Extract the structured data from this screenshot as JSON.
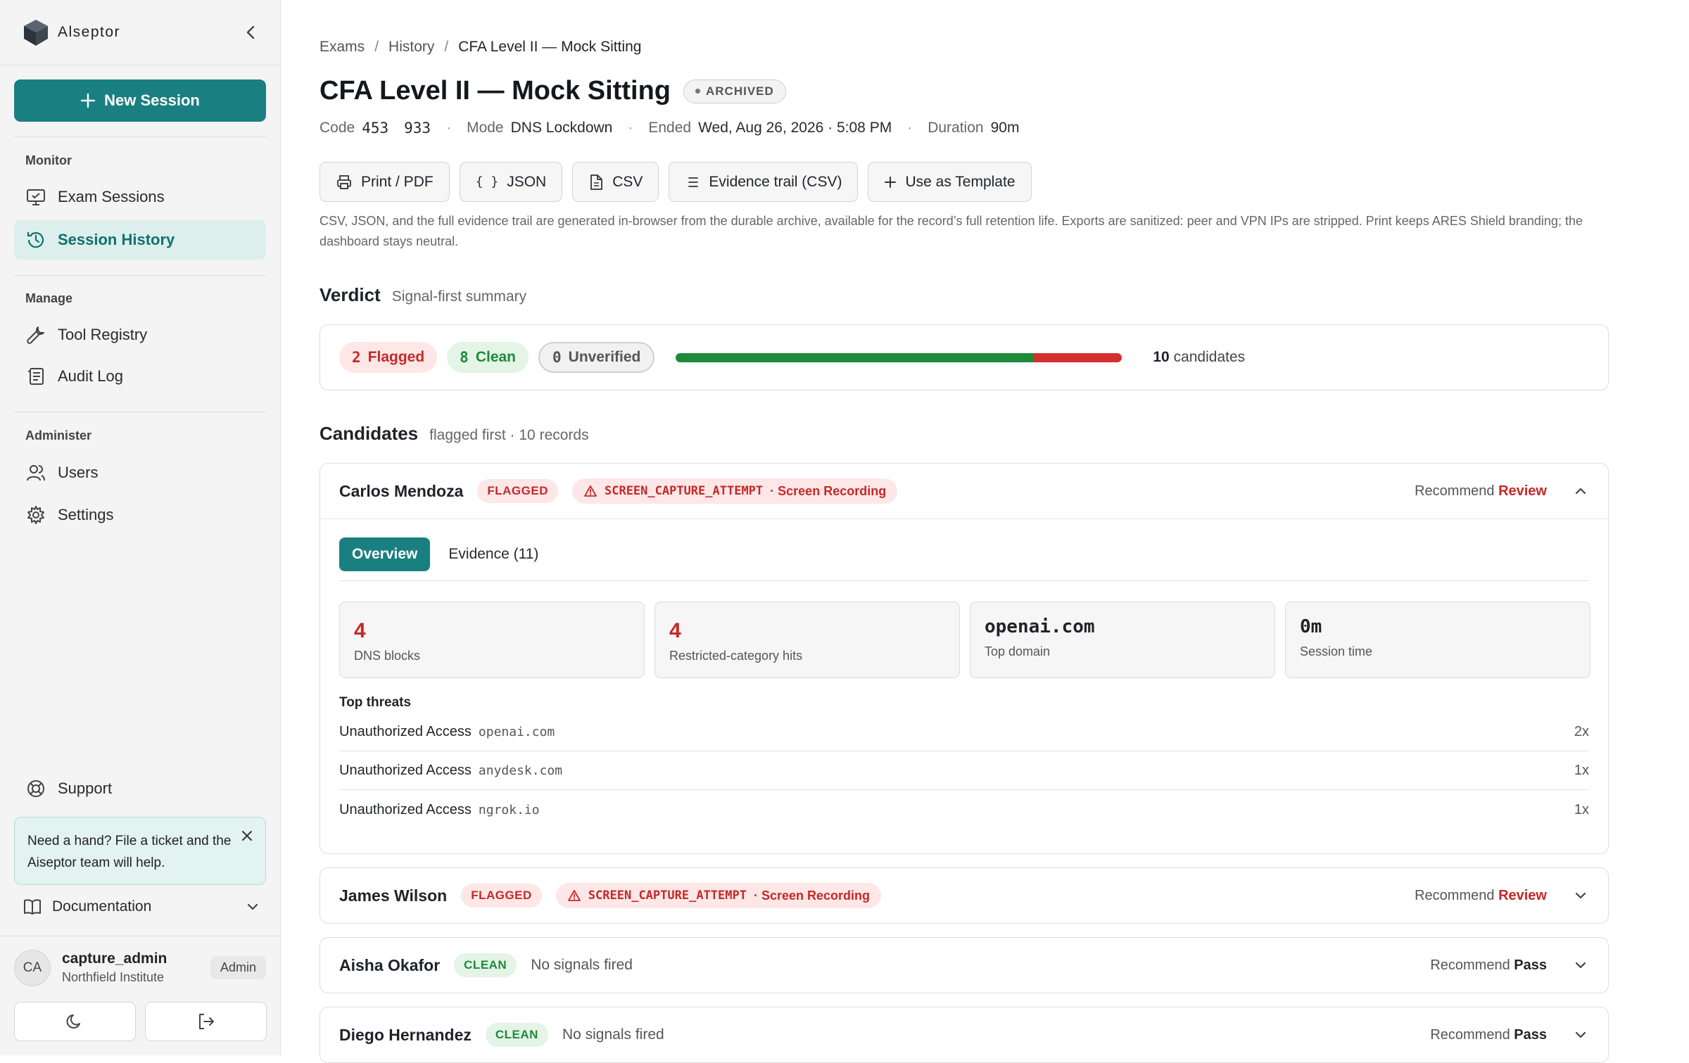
{
  "app": {
    "name": "Alseptor"
  },
  "sidebar": {
    "new_session_label": "New Session",
    "sections": {
      "monitor": "Monitor",
      "manage": "Manage",
      "administer": "Administer"
    },
    "items": {
      "exam_sessions": "Exam Sessions",
      "session_history": "Session History",
      "tool_registry": "Tool Registry",
      "audit_log": "Audit Log",
      "users": "Users",
      "settings": "Settings",
      "support": "Support"
    },
    "help_text": "Need a hand? File a ticket and the Aiseptor team will help.",
    "documentation": "Documentation",
    "user": {
      "initials": "CA",
      "name": "capture_admin",
      "org": "Northfield Institute",
      "role": "Admin"
    }
  },
  "breadcrumb": [
    "Exams",
    "History",
    "CFA Level II — Mock Sitting"
  ],
  "page": {
    "title": "CFA Level II — Mock Sitting",
    "status_badge": "ARCHIVED",
    "meta": {
      "code_label": "Code",
      "code_a": "453",
      "code_b": "933",
      "mode_label": "Mode",
      "mode": "DNS Lockdown",
      "ended_label": "Ended",
      "ended": "Wed, Aug 26, 2026 · 5:08 PM",
      "duration_label": "Duration",
      "duration": "90m"
    }
  },
  "actions": {
    "print": "Print / PDF",
    "json": "JSON",
    "csv": "CSV",
    "evidence": "Evidence trail (CSV)",
    "template": "Use as Template"
  },
  "export_note": "CSV, JSON, and the full evidence trail are generated in-browser from the durable archive, available for the record’s full retention life. Exports are sanitized: peer and VPN IPs are stripped. Print keeps ARES Shield branding; the dashboard stays neutral.",
  "verdict": {
    "title": "Verdict",
    "subtitle": "Signal-first summary",
    "flagged_count": "2",
    "flagged_label": "Flagged",
    "clean_count": "8",
    "clean_label": "Clean",
    "unverified_count": "0",
    "unverified_label": "Unverified",
    "clean_fraction": 0.8,
    "flagged_fraction": 0.2,
    "total": "10",
    "total_label": "candidates",
    "colors": {
      "clean": "#1f8a3b",
      "flagged": "#d32f2f"
    }
  },
  "candidates": {
    "title": "Candidates",
    "subtitle": "flagged first · 10 records",
    "recommend_label": "Recommend",
    "list": [
      {
        "name": "Carlos Mendoza",
        "status": "FLAGGED",
        "signal_code": "SCREEN_CAPTURE_ATTEMPT",
        "signal_label": "· Screen Recording",
        "recommend": "Review",
        "expanded": true,
        "tabs": {
          "overview": "Overview",
          "evidence": "Evidence (11)"
        },
        "stats": [
          {
            "value": "4",
            "label": "DNS blocks"
          },
          {
            "value": "4",
            "label": "Restricted-category hits"
          },
          {
            "value": "openai.com",
            "label": "Top domain"
          },
          {
            "value": "0m",
            "label": "Session time"
          }
        ],
        "threats_title": "Top threats",
        "threats": [
          {
            "category": "Unauthorized Access",
            "domain": "openai.com",
            "count": "2x"
          },
          {
            "category": "Unauthorized Access",
            "domain": "anydesk.com",
            "count": "1x"
          },
          {
            "category": "Unauthorized Access",
            "domain": "ngrok.io",
            "count": "1x"
          }
        ]
      },
      {
        "name": "James Wilson",
        "status": "FLAGGED",
        "signal_code": "SCREEN_CAPTURE_ATTEMPT",
        "signal_label": "· Screen Recording",
        "recommend": "Review",
        "expanded": false
      },
      {
        "name": "Aisha Okafor",
        "status": "CLEAN",
        "signal_text": "No signals fired",
        "recommend": "Pass",
        "expanded": false
      },
      {
        "name": "Diego Hernandez",
        "status": "CLEAN",
        "signal_text": "No signals fired",
        "recommend": "Pass",
        "expanded": false
      }
    ]
  }
}
